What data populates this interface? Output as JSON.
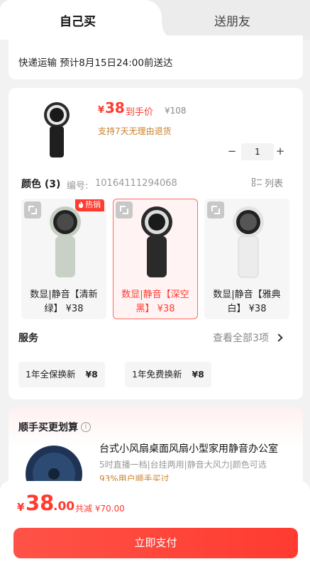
{
  "tabs": {
    "self": "自己买",
    "friend": "送朋友"
  },
  "shipping": {
    "text": "快递运输 预计8月15日24:00前送达"
  },
  "product": {
    "price_symbol": "¥",
    "price": "38",
    "price_tag": "到手价",
    "original_price": "¥108",
    "refund": "支持7天无理由退货",
    "qty_minus": "−",
    "quantity": "1",
    "qty_plus": "+"
  },
  "colors": {
    "label": "颜色 (3)",
    "sku_label": "编号:",
    "sku": "10164111294068",
    "list_label": "列表",
    "hot_badge": "热销",
    "options": [
      {
        "name": "数显|静音【清新绿】 ¥38",
        "color": "#c9d1c6",
        "selected": false
      },
      {
        "name": "数显|静音【深空黑】 ¥38",
        "color": "#2a2a2a",
        "selected": true
      },
      {
        "name": "数显|静音【雅典白】 ¥38",
        "color": "#ececec",
        "selected": false
      }
    ]
  },
  "service": {
    "label": "服务",
    "view_all": "查看全部3项",
    "items": [
      {
        "name": "1年全保换新",
        "price": "¥8"
      },
      {
        "name": "1年免费换新",
        "price": "¥8"
      }
    ]
  },
  "addon": {
    "title": "顺手买更划算",
    "info_icon": "i",
    "name": "台式小风扇桌面风扇小型家用静音办公室",
    "desc": "5时直播一档|台挂两用|静音大风力|颜色可选",
    "rate": "93%用户顺手买过"
  },
  "footer": {
    "symbol": "¥",
    "total_int": "38",
    "total_dec": ".00",
    "saved": "共减 ¥70.00",
    "pay_label": "立即支付"
  },
  "colors_theme": {
    "accent": "#ff3b30",
    "gold": "#c8822d"
  }
}
